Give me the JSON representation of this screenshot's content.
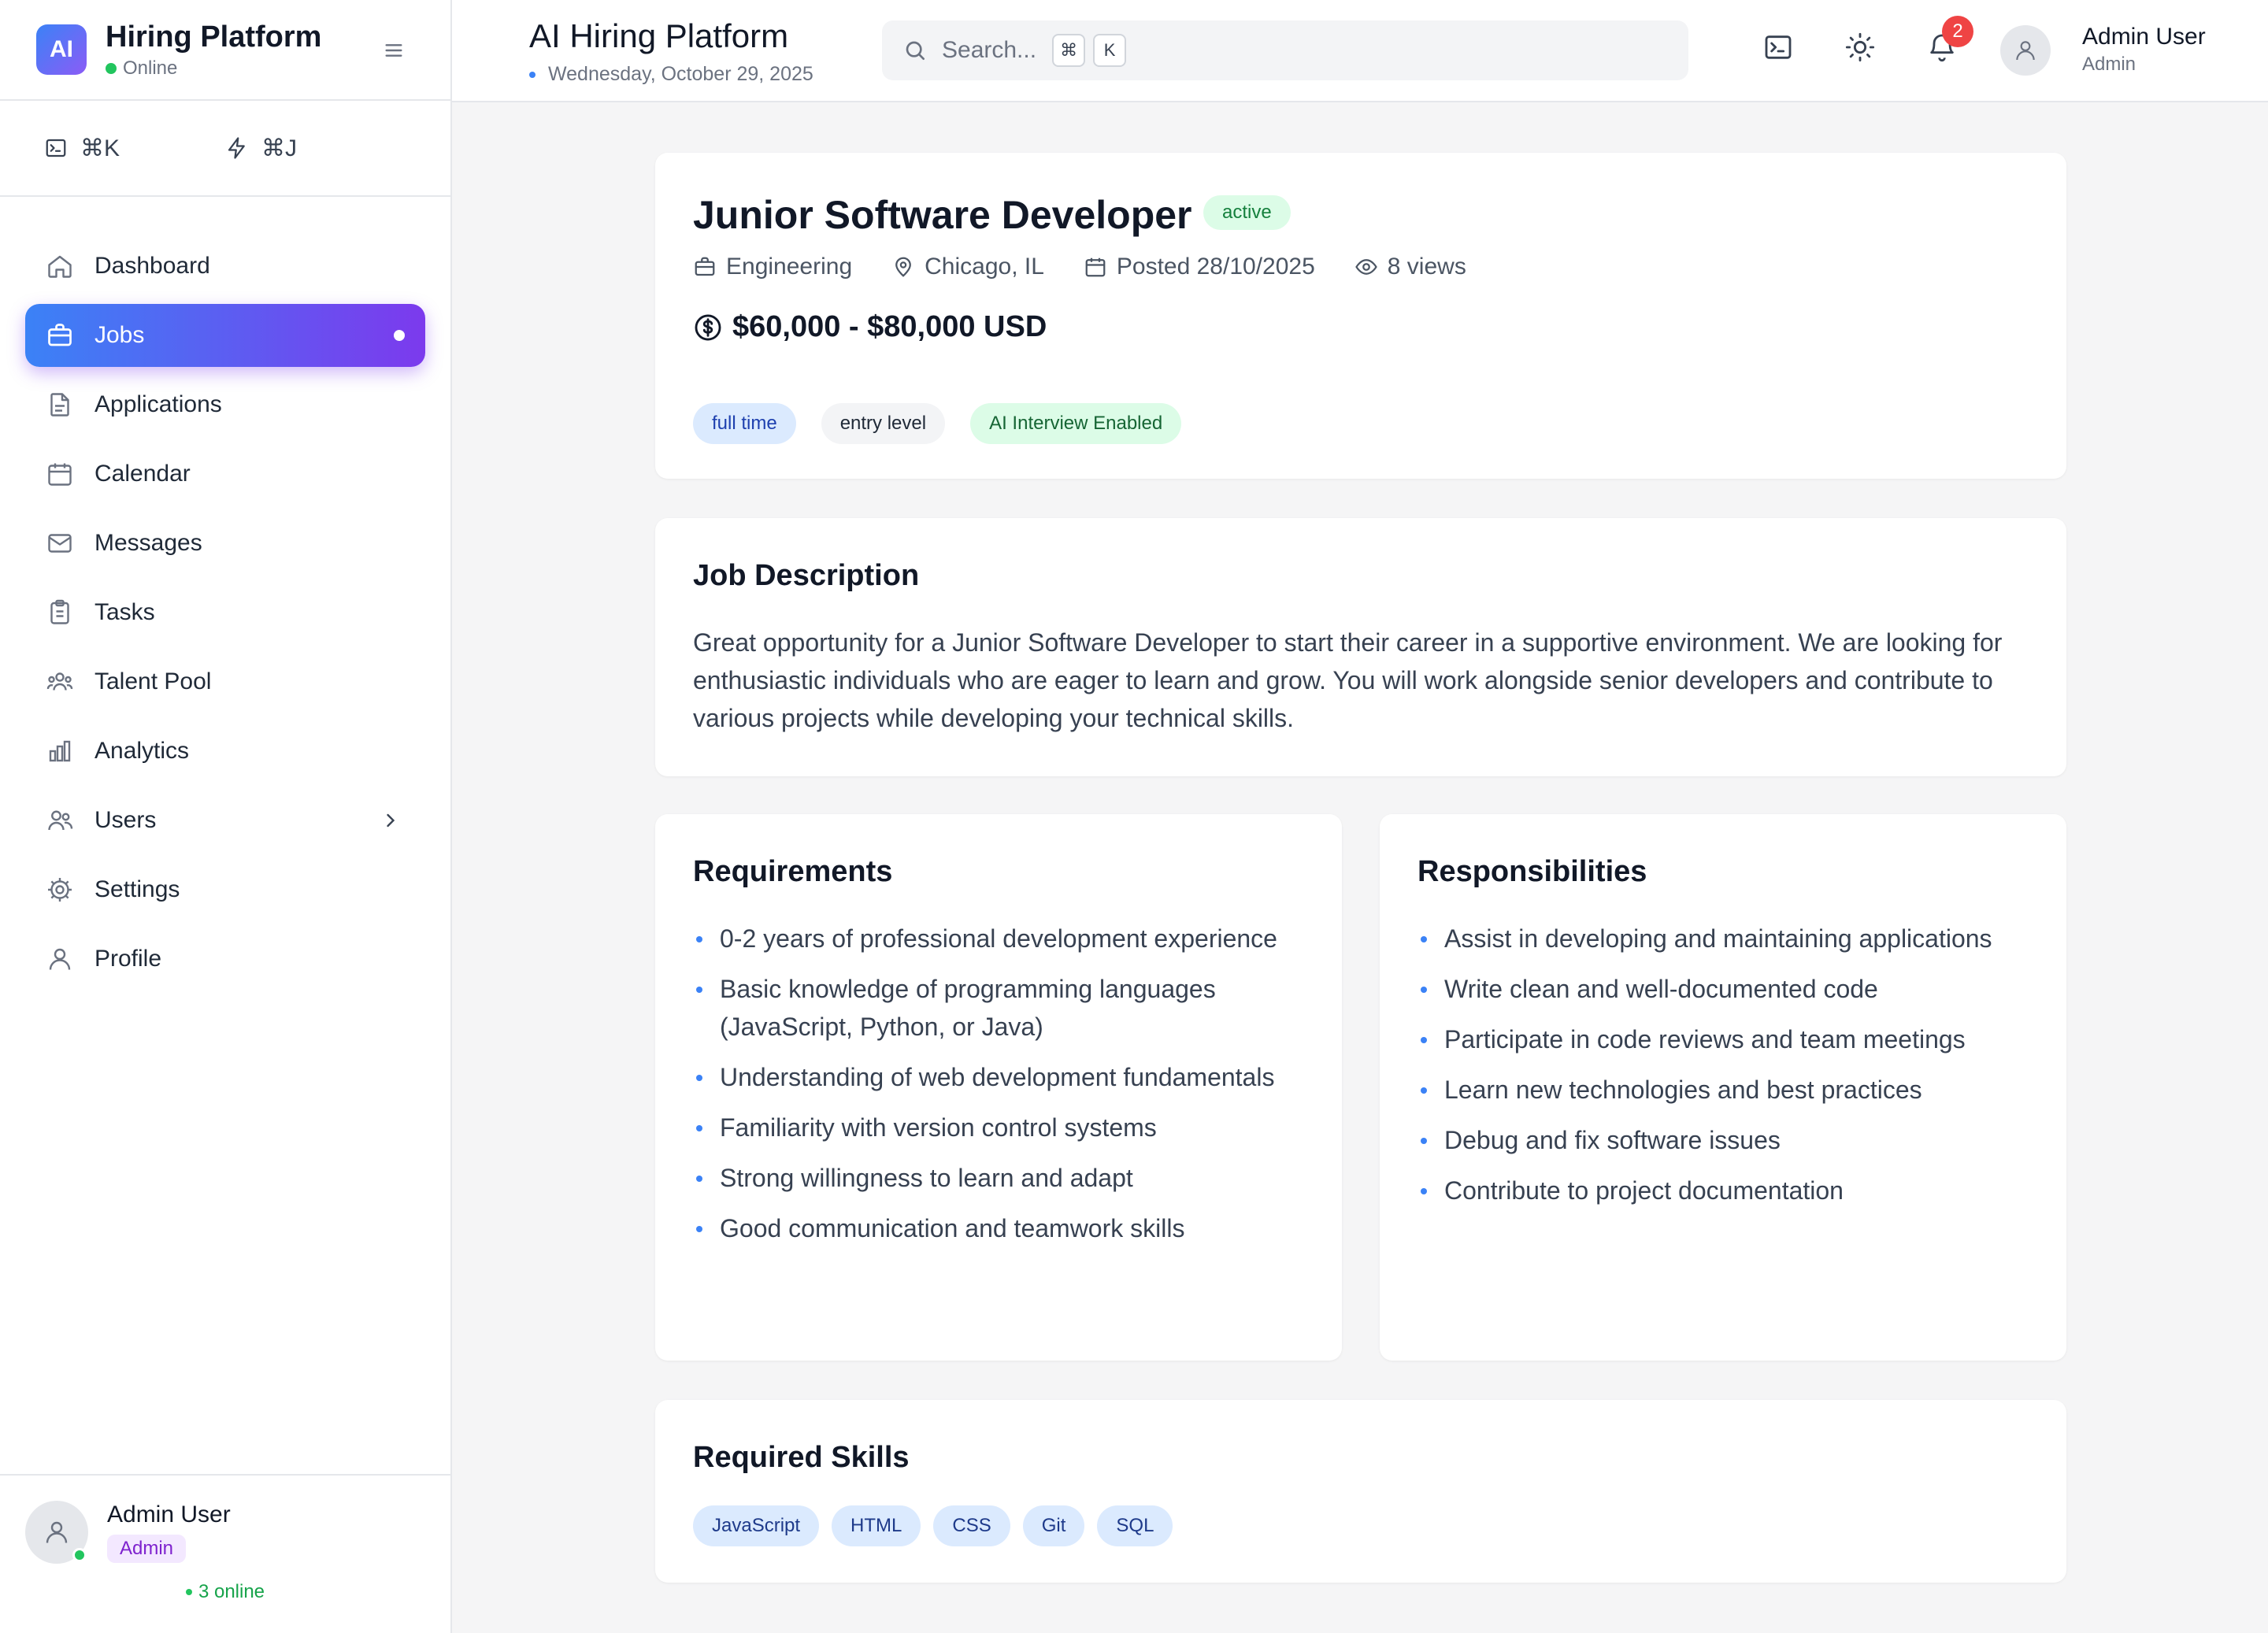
{
  "brand": {
    "logo": "AI",
    "name": "Hiring Platform",
    "status": "Online"
  },
  "shortcuts": [
    {
      "icon": "terminal-icon",
      "label": "⌘K"
    },
    {
      "icon": "lightning-icon",
      "label": "⌘J"
    }
  ],
  "nav": {
    "items": [
      {
        "label": "Dashboard",
        "icon": "home-icon"
      },
      {
        "label": "Jobs",
        "icon": "briefcase-icon",
        "active": true
      },
      {
        "label": "Applications",
        "icon": "file-icon"
      },
      {
        "label": "Calendar",
        "icon": "calendar-icon"
      },
      {
        "label": "Messages",
        "icon": "mail-icon"
      },
      {
        "label": "Tasks",
        "icon": "clipboard-icon"
      },
      {
        "label": "Talent Pool",
        "icon": "users-group-icon"
      },
      {
        "label": "Analytics",
        "icon": "bar-chart-icon"
      },
      {
        "label": "Users",
        "icon": "users-icon",
        "has_submenu": true
      },
      {
        "label": "Settings",
        "icon": "gear-icon"
      },
      {
        "label": "Profile",
        "icon": "user-icon"
      }
    ]
  },
  "sidebar_footer": {
    "name": "Admin User",
    "role": "Admin",
    "online": "3 online"
  },
  "header": {
    "title": "AI Hiring Platform",
    "date": "Wednesday, October 29, 2025",
    "search_placeholder": "Search...",
    "kbd1": "⌘",
    "kbd2": "K",
    "notification_count": "2",
    "user_name": "Admin User",
    "user_role": "Admin"
  },
  "job": {
    "title": "Junior Software Developer",
    "status": "active",
    "department": "Engineering",
    "location": "Chicago, IL",
    "posted": "Posted 28/10/2025",
    "views": "8 views",
    "salary": "$60,000 - $80,000 USD",
    "tags": [
      "full time",
      "entry level",
      "AI Interview Enabled"
    ]
  },
  "description": {
    "heading": "Job Description",
    "text": "Great opportunity for a Junior Software Developer to start their career in a supportive environment. We are looking for enthusiastic individuals who are eager to learn and grow. You will work alongside senior developers and contribute to various projects while developing your technical skills."
  },
  "requirements": {
    "heading": "Requirements",
    "items": [
      "0-2 years of professional development experience",
      "Basic knowledge of programming languages (JavaScript, Python, or Java)",
      "Understanding of web development fundamentals",
      "Familiarity with version control systems",
      "Strong willingness to learn and adapt",
      "Good communication and teamwork skills"
    ]
  },
  "responsibilities": {
    "heading": "Responsibilities",
    "items": [
      "Assist in developing and maintaining applications",
      "Write clean and well-documented code",
      "Participate in code reviews and team meetings",
      "Learn new technologies and best practices",
      "Debug and fix software issues",
      "Contribute to project documentation"
    ]
  },
  "skills": {
    "heading": "Required Skills",
    "items": [
      "JavaScript",
      "HTML",
      "CSS",
      "Git",
      "SQL"
    ]
  },
  "colors": {
    "accent_start": "#3b82f6",
    "accent_end": "#7c3aed",
    "status_green": "#22c55e",
    "notification_red": "#ef4444"
  }
}
